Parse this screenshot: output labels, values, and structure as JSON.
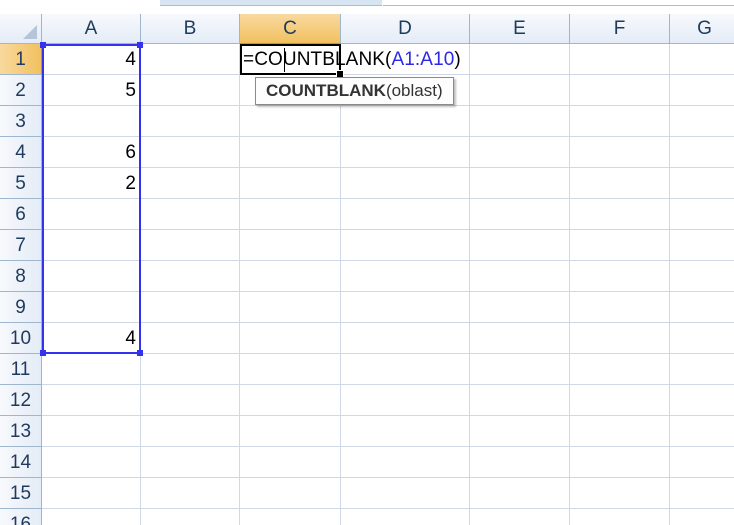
{
  "spreadsheet": {
    "columns": [
      "A",
      "B",
      "C",
      "D",
      "E",
      "F",
      "G"
    ],
    "selected_column": "C",
    "rows": [
      "1",
      "2",
      "3",
      "4",
      "5",
      "6",
      "7",
      "8",
      "9",
      "10",
      "11",
      "12",
      "13",
      "14",
      "15",
      "16"
    ],
    "selected_row": "1",
    "column_a_values": [
      "4",
      "5",
      "",
      "6",
      "2",
      "",
      "",
      "",
      "",
      "4",
      "",
      "",
      "",
      "",
      "",
      ""
    ],
    "active_cell": "C1",
    "formula": {
      "prefix": "=COUNTBLANK(",
      "range": "A1:A10",
      "suffix": ")"
    },
    "tooltip": {
      "function_name": "COUNTBLANK",
      "argument": "(oblast)"
    }
  },
  "colors": {
    "range_highlight": "#3333ee",
    "selected_header": "#f1c15f",
    "header_background": "#e4ecf7",
    "gridline": "#d0d7e5"
  }
}
